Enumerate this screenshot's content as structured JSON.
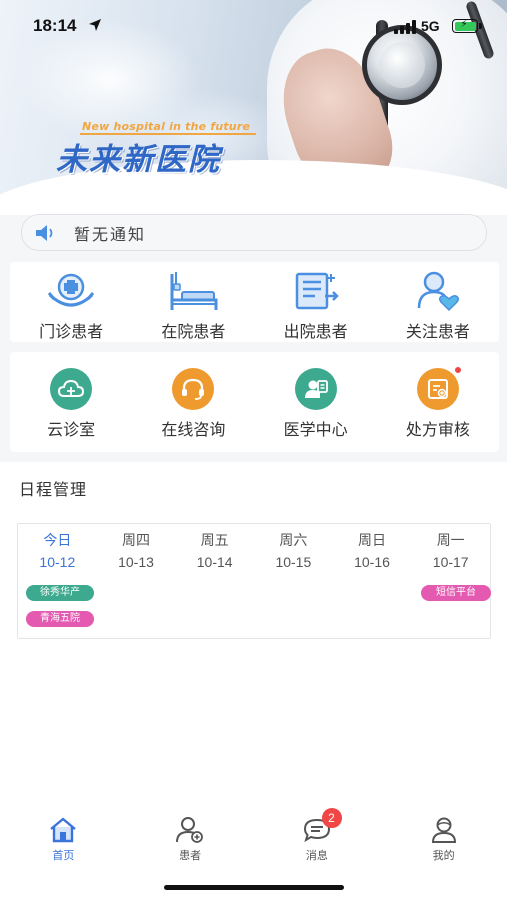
{
  "status_bar": {
    "time": "18:14",
    "network": "5G"
  },
  "banner": {
    "slogan_en": "New hospital in the future",
    "slogan_cn": "未来新医院"
  },
  "notice": {
    "icon": "speaker-icon",
    "text": "暂无通知"
  },
  "patient_menu": [
    {
      "label": "门诊患者",
      "icon": "outpatient-icon"
    },
    {
      "label": "在院患者",
      "icon": "hospital-bed-icon"
    },
    {
      "label": "出院患者",
      "icon": "discharge-icon"
    },
    {
      "label": "关注患者",
      "icon": "followed-patient-icon"
    }
  ],
  "service_menu": [
    {
      "label": "云诊室",
      "icon": "cloud-clinic-icon",
      "color": "#3daa8f"
    },
    {
      "label": "在线咨询",
      "icon": "headset-icon",
      "color": "#ee9a2e"
    },
    {
      "label": "医学中心",
      "icon": "medical-center-icon",
      "color": "#3daa8f"
    },
    {
      "label": "处方审核",
      "icon": "prescription-icon",
      "color": "#ee9a2e"
    }
  ],
  "schedule": {
    "title": "日程管理",
    "days": [
      {
        "weekday": "今日",
        "date": "10-12",
        "today": true
      },
      {
        "weekday": "周四",
        "date": "10-13"
      },
      {
        "weekday": "周五",
        "date": "10-14"
      },
      {
        "weekday": "周六",
        "date": "10-15"
      },
      {
        "weekday": "周日",
        "date": "10-16"
      },
      {
        "weekday": "周一",
        "date": "10-17"
      }
    ],
    "events": [
      {
        "text": "徐秀华产",
        "day": "10-12",
        "color": "#3daa8f"
      },
      {
        "text": "青海五院",
        "day": "10-12",
        "color": "#e35ab0"
      },
      {
        "text": "短信平台",
        "day": "10-17",
        "color": "#e35ab0"
      }
    ]
  },
  "tabbar": [
    {
      "label": "首页",
      "icon": "home-icon",
      "active": true
    },
    {
      "label": "患者",
      "icon": "patient-icon"
    },
    {
      "label": "消息",
      "icon": "message-icon",
      "badge": "2"
    },
    {
      "label": "我的",
      "icon": "profile-icon"
    }
  ],
  "colors": {
    "accent": "#3a73d9",
    "teal": "#3daa8f",
    "orange": "#ee9a2e",
    "pink": "#e35ab0",
    "badge": "#f04646"
  }
}
